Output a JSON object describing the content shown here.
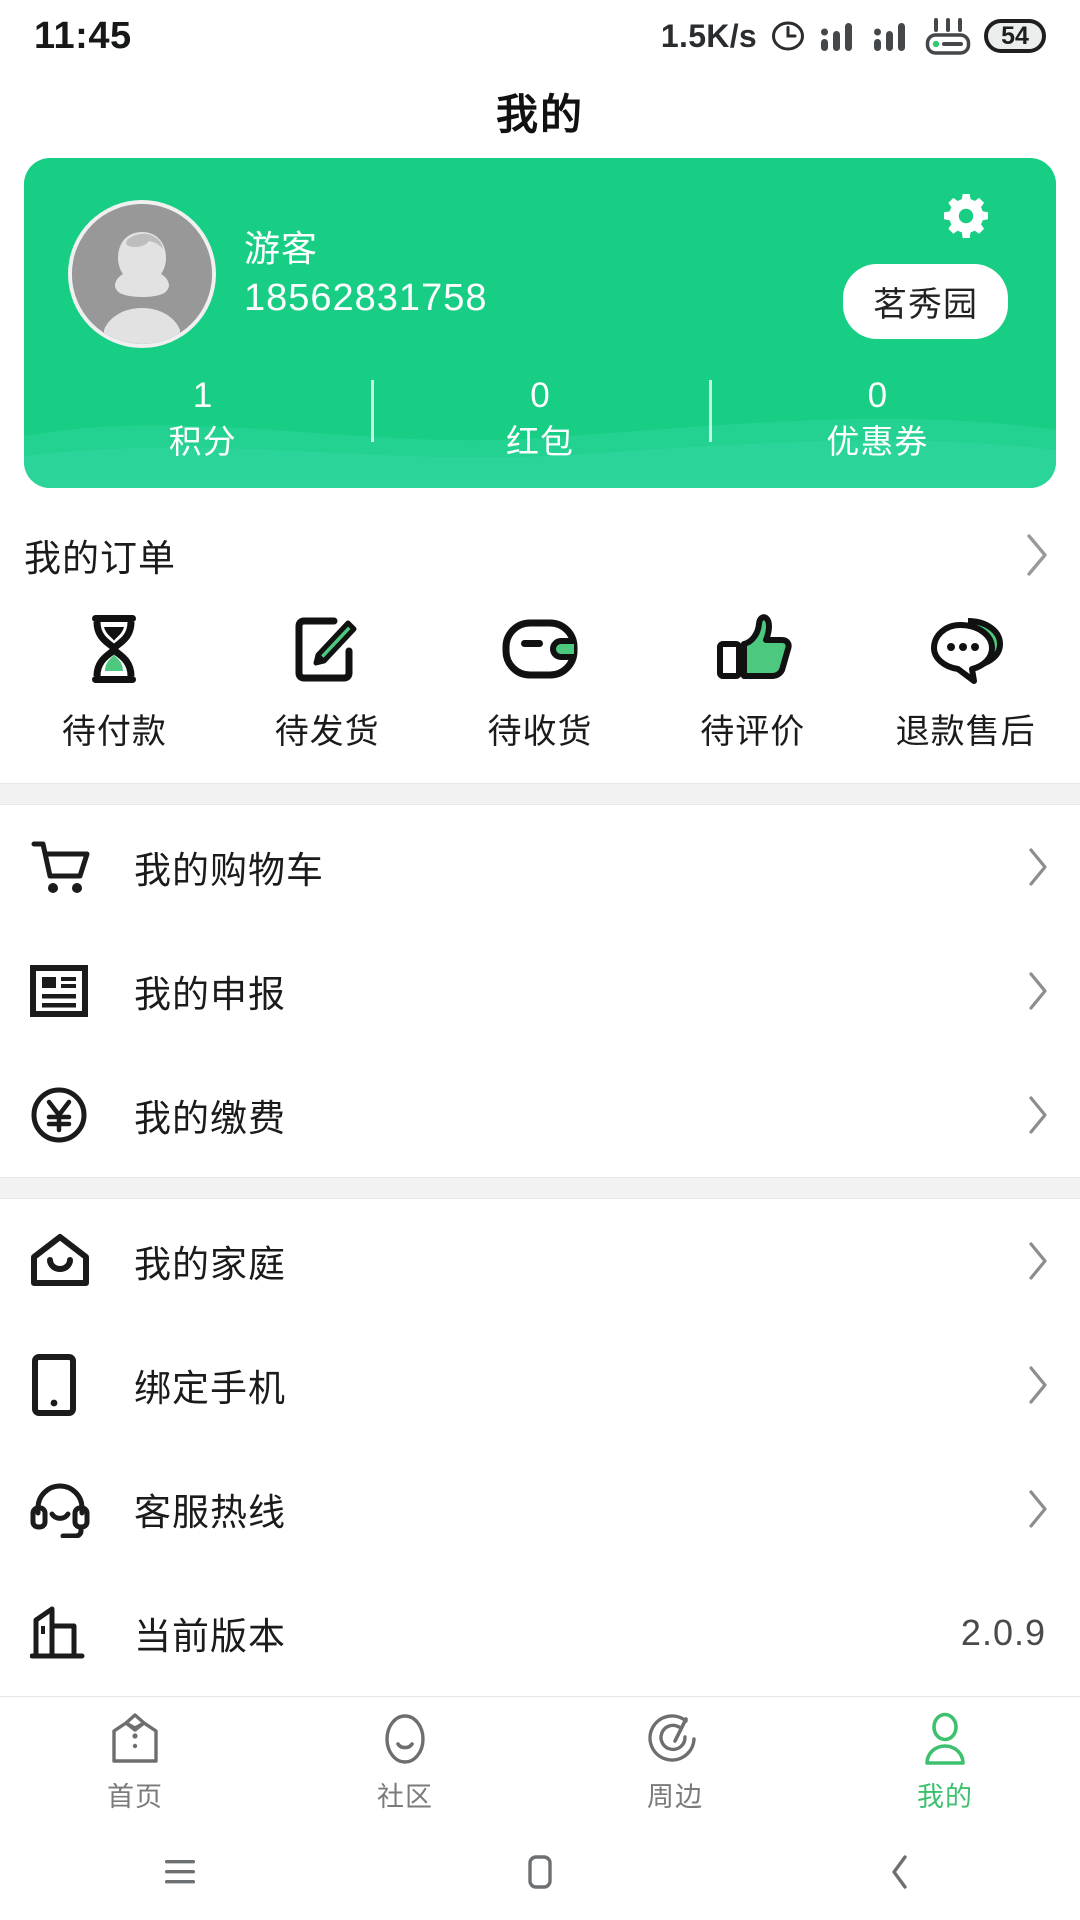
{
  "status_bar": {
    "time": "11:45",
    "network_speed": "1.5K/s",
    "clock_icon": "alarm-clock-icon",
    "signal1_icon": "signal-bars-icon",
    "signal2_icon": "signal-bars-icon",
    "wifi_icon": "wifi-router-icon",
    "battery_level": "54"
  },
  "header": {
    "title": "我的"
  },
  "profile": {
    "avatar_icon": "default-avatar-icon",
    "name": "游客",
    "phone": "18562831758",
    "settings_icon": "gear-icon",
    "community_badge": "茗秀园",
    "stats": [
      {
        "value": "1",
        "label": "积分"
      },
      {
        "value": "0",
        "label": "红包"
      },
      {
        "value": "0",
        "label": "优惠券"
      }
    ]
  },
  "orders": {
    "title": "我的订单",
    "chevron_icon": "chevron-right-icon",
    "items": [
      {
        "label": "待付款",
        "icon": "hourglass-icon"
      },
      {
        "label": "待发货",
        "icon": "edit-pencil-icon"
      },
      {
        "label": "待收货",
        "icon": "wallet-icon"
      },
      {
        "label": "待评价",
        "icon": "thumbs-up-icon"
      },
      {
        "label": "退款售后",
        "icon": "chat-bubble-icon"
      }
    ]
  },
  "menu_group_1": [
    {
      "label": "我的购物车",
      "icon": "shopping-cart-icon",
      "value": ""
    },
    {
      "label": "我的申报",
      "icon": "document-icon",
      "value": ""
    },
    {
      "label": "我的缴费",
      "icon": "yen-circle-icon",
      "value": ""
    }
  ],
  "menu_group_2": [
    {
      "label": "我的家庭",
      "icon": "home-icon",
      "value": ""
    },
    {
      "label": "绑定手机",
      "icon": "mobile-phone-icon",
      "value": ""
    },
    {
      "label": "客服热线",
      "icon": "headset-icon",
      "value": ""
    },
    {
      "label": "当前版本",
      "icon": "building-icon",
      "value": "2.0.9"
    }
  ],
  "tabbar": [
    {
      "label": "首页",
      "icon": "butler-icon",
      "active": false
    },
    {
      "label": "社区",
      "icon": "face-icon",
      "active": false
    },
    {
      "label": "周边",
      "icon": "location-pulse-icon",
      "active": false
    },
    {
      "label": "我的",
      "icon": "person-icon",
      "active": true
    }
  ],
  "system_nav": [
    {
      "icon": "menu-icon"
    },
    {
      "icon": "home-square-icon"
    },
    {
      "icon": "back-chevron-icon"
    }
  ],
  "colors": {
    "brand_green": "#17ce84",
    "accent_green": "#3ec16f",
    "icon_green": "#4cc97f",
    "text_dark": "#1b1b1b",
    "chevron_gray": "#888888",
    "divider_gray": "#f2f2f2"
  }
}
